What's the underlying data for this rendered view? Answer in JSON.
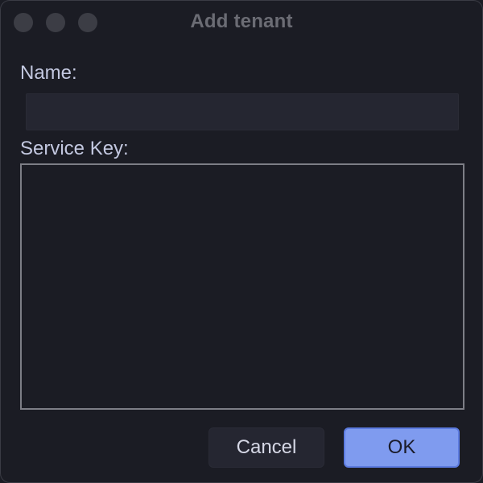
{
  "window": {
    "title": "Add tenant"
  },
  "form": {
    "name_label": "Name:",
    "name_value": "",
    "service_key_label": "Service Key:",
    "service_key_value": ""
  },
  "buttons": {
    "cancel_label": "Cancel",
    "ok_label": "OK"
  },
  "colors": {
    "background": "#1b1c24",
    "accent": "#7f9bef",
    "label_text": "#c3c8e0"
  }
}
